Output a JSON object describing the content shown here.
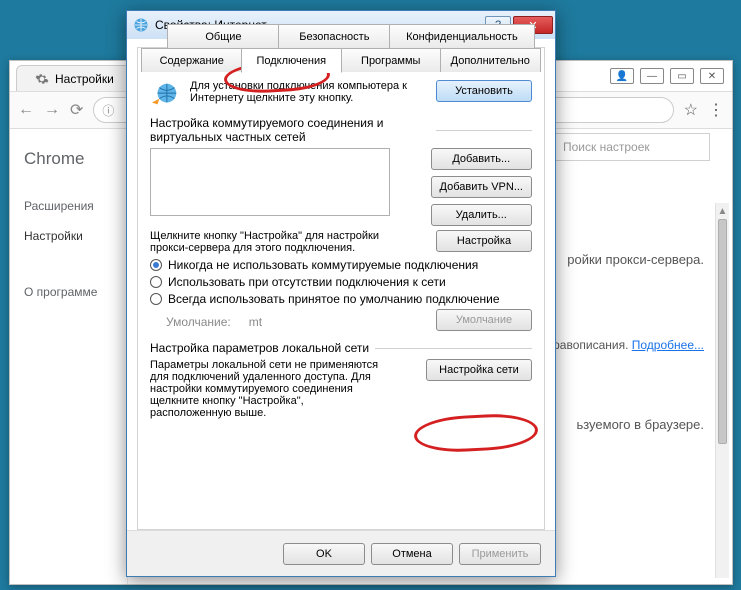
{
  "chrome": {
    "tab_title": "Настройки",
    "app_name": "Chrome",
    "nav_items": [
      "Расширения",
      "Настройки"
    ],
    "nav_active_index": 1,
    "footer_item": "О программе",
    "search_placeholder": "Поиск настроек",
    "frag_proxy": "ройки прокси-сервера.",
    "frag_spell_pre": "и правописания. ",
    "frag_spell_link": "Подробнее...",
    "frag_browser": "ьзуемого в браузере."
  },
  "dialog": {
    "title": "Свойства: Интернет",
    "tabs_row1": [
      "Общие",
      "Безопасность",
      "Конфиденциальность"
    ],
    "tabs_row2": [
      "Содержание",
      "Подключения",
      "Программы",
      "Дополнительно"
    ],
    "active_tab": "Подключения",
    "setup_text": "Для установки подключения компьютера к Интернету щелкните эту кнопку.",
    "btn_setup": "Установить",
    "section_dialup": "Настройка коммутируемого соединения и виртуальных частных сетей",
    "btn_add": "Добавить...",
    "btn_add_vpn": "Добавить VPN...",
    "btn_remove": "Удалить...",
    "proxy_note": "Щелкните кнопку \"Настройка\" для настройки прокси-сервера для этого подключения.",
    "btn_settings": "Настройка",
    "radio_never": "Никогда не использовать коммутируемые подключения",
    "radio_absent": "Использовать при отсутствии подключения к сети",
    "radio_always": "Всегда использовать принятое по умолчанию подключение",
    "default_label": "Умолчание:",
    "default_value": "mt",
    "btn_default": "Умолчание",
    "section_lan": "Настройка параметров локальной сети",
    "lan_text": "Параметры локальной сети не применяются для подключений удаленного доступа. Для настройки коммутируемого соединения щелкните кнопку \"Настройка\", расположенную выше.",
    "btn_lan": "Настройка сети",
    "btn_ok": "OK",
    "btn_cancel": "Отмена",
    "btn_apply": "Применить"
  }
}
